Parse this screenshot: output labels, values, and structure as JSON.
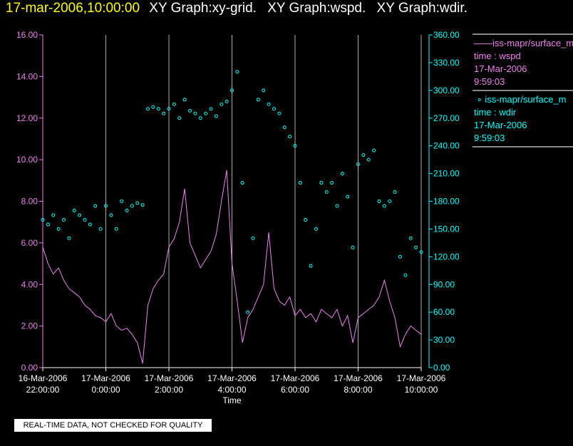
{
  "header": {
    "timestamp": "17-mar-2006,10:00:00",
    "graphs": [
      "XY Graph:xy-grid.",
      "XY Graph:wspd.",
      "XY Graph:wdir."
    ]
  },
  "legend": [
    {
      "symbol": "line",
      "label": "iss-mapr/surface_m",
      "var": "time : wspd",
      "date": "17-Mar-2006",
      "time": "9:59:03"
    },
    {
      "symbol": "circle",
      "label": "iss-mapr/surface_m",
      "var": "time : wdir",
      "date": "17-Mar-2006",
      "time": "9:59:03"
    }
  ],
  "footer": "REAL-TIME DATA, NOT CHECKED FOR QUALITY",
  "colors": {
    "wspd": "#ee82ee",
    "wdir": "#00ffff",
    "grid": "#aaaaaa"
  },
  "chart_data": {
    "type": "line+scatter",
    "xlabel": "Time",
    "x_ticks": [
      {
        "d": "16-Mar-2006",
        "t": "22:00:00"
      },
      {
        "d": "17-Mar-2006",
        "t": "0:00:00"
      },
      {
        "d": "17-Mar-2006",
        "t": "2:00:00"
      },
      {
        "d": "17-Mar-2006",
        "t": "4:00:00"
      },
      {
        "d": "17-Mar-2006",
        "t": "6:00:00"
      },
      {
        "d": "17-Mar-2006",
        "t": "8:00:00"
      },
      {
        "d": "17-Mar-2006",
        "t": "10:00:00"
      }
    ],
    "x_range_hours": [
      0,
      12
    ],
    "x_step_minutes": 10,
    "y_left": {
      "range": [
        0,
        16
      ],
      "ticks": [
        "0.00",
        "2.00",
        "4.00",
        "6.00",
        "8.00",
        "10.00",
        "12.00",
        "14.00",
        "16.00"
      ]
    },
    "y_right": {
      "range": [
        0,
        360
      ],
      "ticks": [
        "0.00",
        "30.00",
        "60.00",
        "90.00",
        "120.00",
        "150.00",
        "180.00",
        "210.00",
        "240.00",
        "270.00",
        "300.00",
        "330.00",
        "360.00"
      ]
    },
    "series": [
      {
        "name": "wspd",
        "axis": "left",
        "type": "line",
        "values": [
          5.8,
          5.0,
          4.5,
          4.8,
          4.2,
          3.8,
          3.6,
          3.4,
          3.0,
          2.8,
          2.5,
          2.4,
          2.2,
          2.6,
          2.0,
          1.8,
          1.9,
          1.6,
          1.2,
          0.2,
          3.0,
          3.8,
          4.2,
          4.5,
          5.8,
          6.2,
          7.0,
          8.6,
          6.0,
          5.4,
          4.8,
          5.2,
          5.6,
          6.4,
          8.0,
          9.5,
          5.0,
          3.2,
          1.2,
          2.4,
          2.8,
          3.4,
          4.0,
          6.5,
          3.8,
          3.2,
          3.0,
          3.4,
          2.5,
          2.8,
          2.4,
          2.6,
          2.2,
          2.8,
          2.6,
          2.4,
          2.8,
          2.0,
          2.5,
          1.2,
          2.4,
          2.6,
          2.8,
          3.0,
          3.4,
          4.2,
          3.2,
          2.4,
          1.0,
          1.6,
          2.0,
          1.8,
          1.6
        ]
      },
      {
        "name": "wdir",
        "axis": "right",
        "type": "scatter",
        "values": [
          160,
          155,
          165,
          150,
          160,
          140,
          170,
          165,
          160,
          155,
          175,
          150,
          175,
          165,
          150,
          180,
          170,
          175,
          178,
          176,
          280,
          282,
          280,
          275,
          280,
          285,
          270,
          290,
          278,
          275,
          270,
          275,
          280,
          272,
          285,
          288,
          300,
          320,
          200,
          60,
          140,
          290,
          300,
          285,
          280,
          275,
          260,
          250,
          240,
          200,
          160,
          110,
          150,
          200,
          190,
          200,
          175,
          210,
          185,
          130,
          220,
          230,
          225,
          235,
          180,
          175,
          180,
          190,
          120,
          100,
          140,
          130,
          125
        ]
      }
    ]
  }
}
